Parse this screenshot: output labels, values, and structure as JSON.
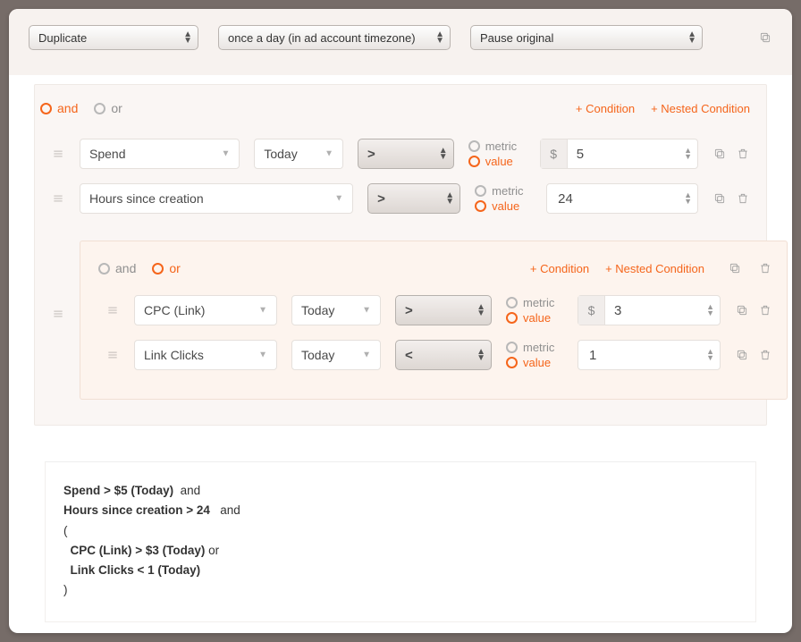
{
  "topbar": {
    "action": "Duplicate",
    "frequency": "once a day (in ad account timezone)",
    "then": "Pause original"
  },
  "root": {
    "logic": "and",
    "add_condition": "+ Condition",
    "add_nested": "+ Nested Condition",
    "rows": [
      {
        "metric": "Spend",
        "range": "Today",
        "op": ">",
        "mode": "value",
        "prefix": "$",
        "value": "5"
      },
      {
        "metric": "Hours since creation",
        "range": null,
        "op": ">",
        "mode": "value",
        "prefix": null,
        "value": "24"
      }
    ]
  },
  "nested": {
    "logic": "or",
    "add_condition": "+ Condition",
    "add_nested": "+ Nested Condition",
    "rows": [
      {
        "metric": "CPC (Link)",
        "range": "Today",
        "op": ">",
        "mode": "value",
        "prefix": "$",
        "value": "3"
      },
      {
        "metric": "Link Clicks",
        "range": "Today",
        "op": "<",
        "mode": "value",
        "prefix": null,
        "value": "1"
      }
    ]
  },
  "labels": {
    "metric": "metric",
    "value": "value"
  },
  "summary": {
    "l1a": "Spend > $5 (Today)",
    "l1b": "  and",
    "l2a": "Hours since creation > 24",
    "l2b": "   and",
    "l3": "(",
    "l4a": "  CPC (Link) > $3 (Today)",
    "l4b": " or",
    "l5": "  Link Clicks < 1 (Today)",
    "l6": ")"
  }
}
